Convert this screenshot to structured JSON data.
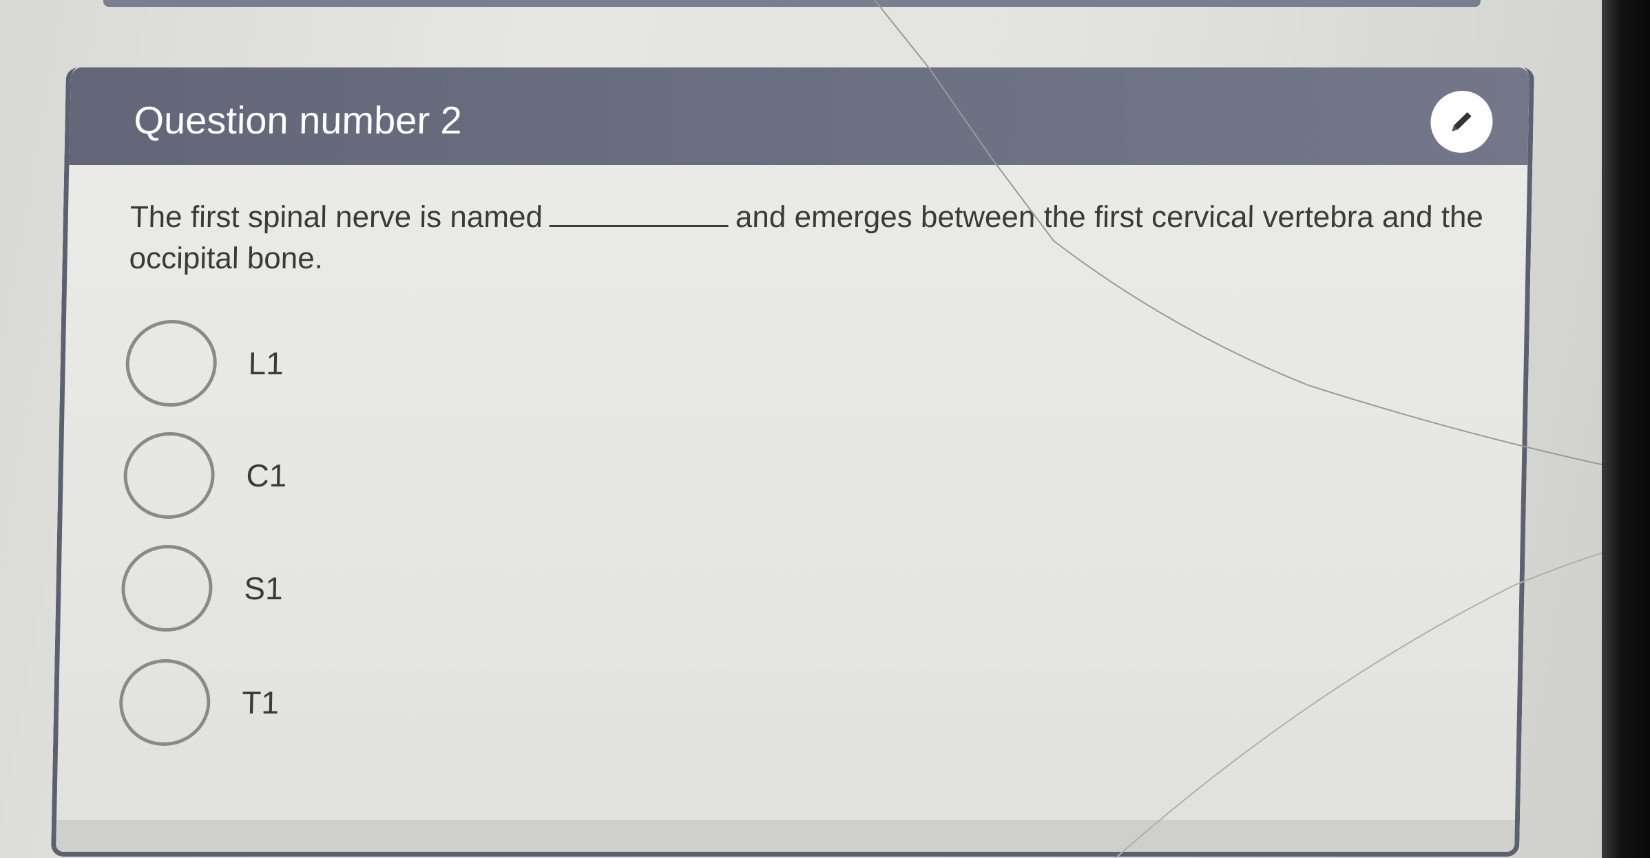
{
  "card": {
    "title": "Question number 2",
    "edit_icon": "pencil-icon"
  },
  "question": {
    "text_before": "The first spinal nerve is named",
    "text_after": "and emerges between the first cervical vertebra and the occipital bone."
  },
  "options": [
    {
      "label": "L1"
    },
    {
      "label": "C1"
    },
    {
      "label": "S1"
    },
    {
      "label": "T1"
    }
  ],
  "colors": {
    "header_bg": "#6b6f82",
    "card_border": "#5c6170",
    "text": "#3a3a3a",
    "radio_border": "#8a8a86"
  }
}
